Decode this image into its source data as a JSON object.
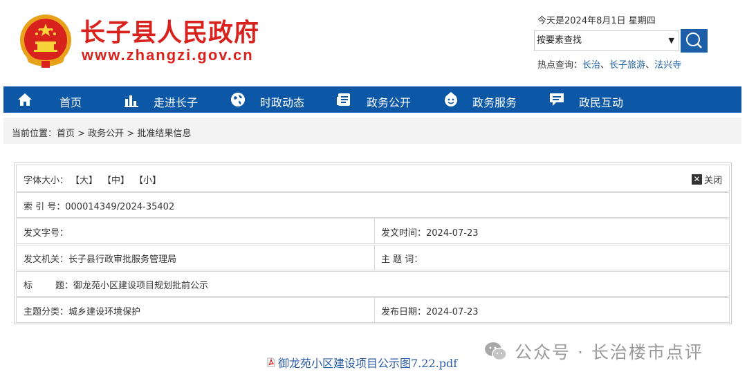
{
  "header": {
    "site_title": "长子县人民政府",
    "site_domain": "www.zhangzi.gov.cn",
    "date_text": "今天是2024年8月1日 星期四",
    "search": {
      "selected_option": "按要素查找"
    },
    "hot_search": {
      "label": "热点查询：",
      "links": [
        "长治",
        "长子旅游",
        "法兴寺"
      ],
      "separator": "、"
    }
  },
  "nav": {
    "items": [
      {
        "label": "首页",
        "icon": "home-icon"
      },
      {
        "label": "走进长子",
        "icon": "bar-chart-icon"
      },
      {
        "label": "时政动态",
        "icon": "globe-icon"
      },
      {
        "label": "政务公开",
        "icon": "document-icon"
      },
      {
        "label": "政务服务",
        "icon": "service-icon"
      },
      {
        "label": "政民互动",
        "icon": "chat-icon"
      }
    ]
  },
  "breadcrumb": {
    "text": "当前位置：首页 > 政务公开 > 批准结果信息"
  },
  "info": {
    "font_size_label": "字体大小：",
    "font_large": "【大】",
    "font_medium": "【中】",
    "font_small": "【小】",
    "close_label": "关闭",
    "index_no": "索  引  号：000014349/2024-35402",
    "doc_no": "发文字号：",
    "issue_time": "发文时间：2024-07-23",
    "issuing_org": "发文机关：长子县行政审批服务管理局",
    "keywords": "主  题  词：",
    "title_row": "标        题：御龙苑小区建设项目规划批前公示",
    "category": "主题分类：城乡建设环境保护",
    "publish_date": "发布日期：2024-07-23"
  },
  "attachment": {
    "filename": "御龙苑小区建设项目公示图7.22.pdf"
  },
  "watermark": {
    "text": "公众号 · 长治楼市点评"
  },
  "colors": {
    "brand_red": "#d8221d",
    "nav_blue": "#0c58a6",
    "link_blue": "#1e5fa5"
  }
}
